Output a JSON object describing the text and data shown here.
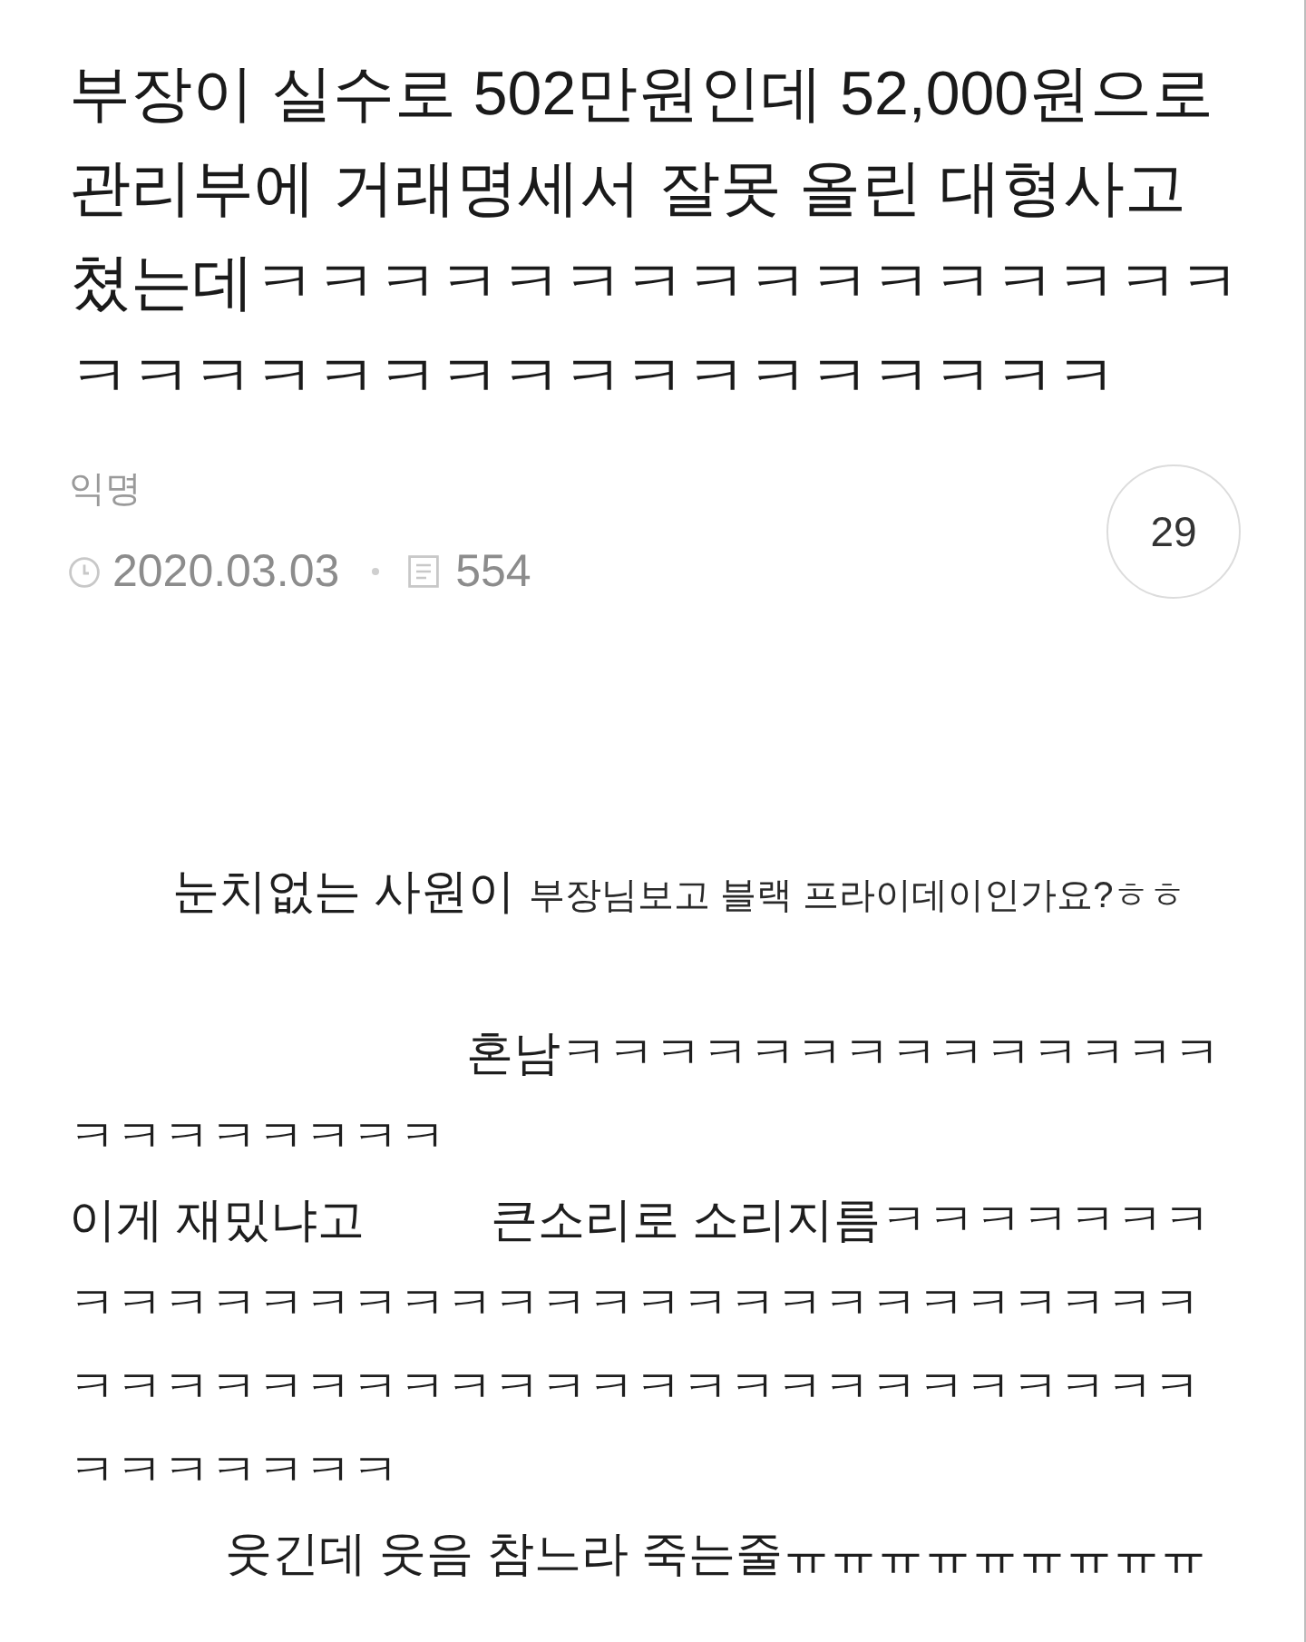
{
  "post": {
    "title": "부장이 실수로 502만원인데 52,000원으로 관리부에 거래명세서 잘못 올린 대형사고쳤는데ㅋㅋㅋㅋㅋㅋㅋㅋㅋㅋㅋㅋㅋㅋㅋㅋㅋㅋㅋㅋㅋㅋㅋㅋㅋㅋㅋㅋㅋㅋㅋㅋㅋ",
    "author": "익명",
    "date": "2020.03.03",
    "count": "554",
    "circle_number": "29"
  },
  "body": [
    {
      "segments": [
        {
          "text": "눈치없는 사원이",
          "kind": "large"
        },
        {
          "text": "부장님보고 블랙 프라이데이인가요?ㅎㅎ",
          "kind": "small"
        }
      ]
    },
    {
      "segments": [
        {
          "text": "혼남ㅋㅋㅋㅋㅋㅋㅋㅋㅋㅋㅋㅋㅋㅋㅋㅋㅋㅋㅋㅋㅋㅋ",
          "kind": "large"
        }
      ]
    },
    {
      "segments": [
        {
          "text": "이게 재밌냐고",
          "kind": "large"
        },
        {
          "text": "큰소리로 소리지름ㅋㅋㅋㅋㅋㅋㅋㅋㅋㅋㅋㅋㅋㅋㅋㅋㅋㅋㅋㅋㅋㅋㅋㅋㅋㅋㅋㅋㅋㅋㅋㅋㅋㅋㅋㅋㅋㅋㅋㅋㅋㅋㅋㅋㅋㅋㅋㅋㅋㅋㅋㅋㅋㅋㅋㅋㅋㅋㅋㅋㅋㅋ",
          "kind": "large"
        }
      ]
    },
    {
      "segments": [
        {
          "text": "웃긴데 웃음 참느라 죽는줄ㅠㅠㅠㅠㅠㅠㅠㅠㅠ",
          "kind": "large"
        }
      ]
    }
  ]
}
